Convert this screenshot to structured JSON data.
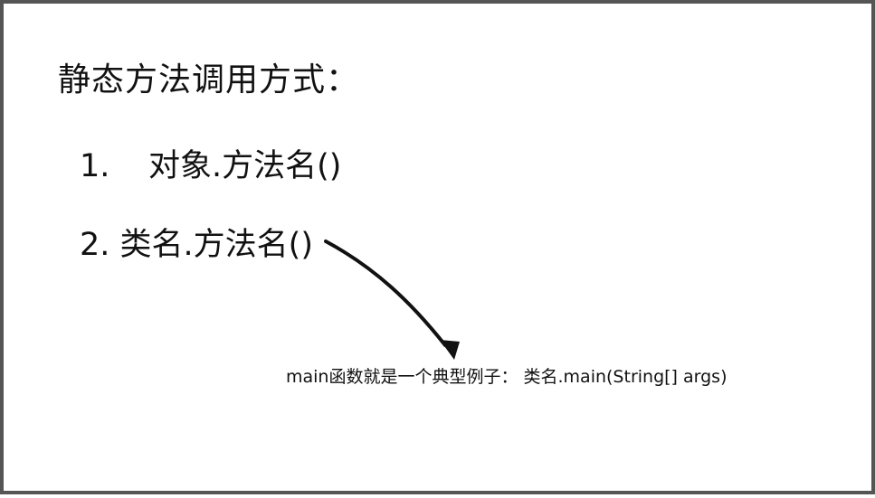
{
  "slide": {
    "title": "静态方法调用方式：",
    "items": [
      {
        "number": "1.",
        "text": "对象.方法名()"
      },
      {
        "number": "2.",
        "text": "类名.方法名()"
      }
    ],
    "note": "main函数就是一个典型例子： 类名.main(String[] args)",
    "border_color": "#555555",
    "text_color": "#111111"
  }
}
